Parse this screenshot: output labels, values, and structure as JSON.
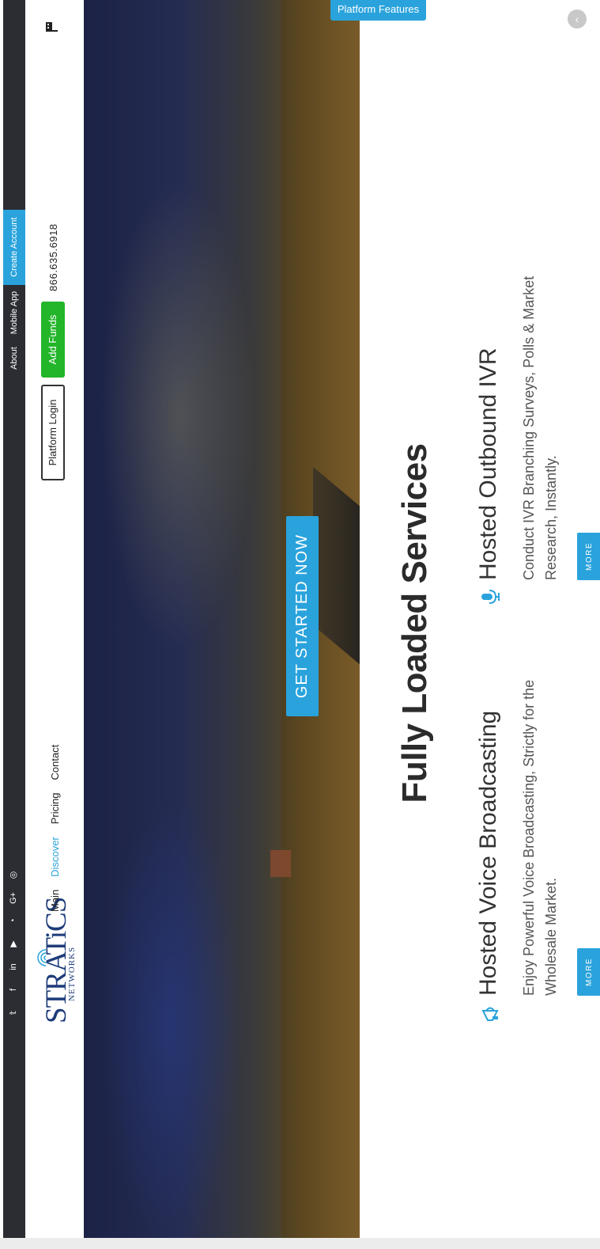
{
  "topbar": {
    "social_icons": [
      "twitter-icon",
      "facebook-icon",
      "linkedin-icon",
      "youtube-icon",
      "rss-icon",
      "google-plus-icon",
      "instagram-icon"
    ],
    "social_glyphs": [
      "𝕥",
      "f",
      "in",
      "▶",
      "◔",
      "G+",
      "◎"
    ],
    "links": {
      "about": "About",
      "mobile_app": "Mobile App",
      "create_account": "Create Account"
    }
  },
  "header": {
    "logo_word": "STRATiCS",
    "logo_sub": "NETWORKS",
    "nav": [
      "Main",
      "Discover",
      "Pricing",
      "Contact"
    ],
    "active_nav": "Discover",
    "platform_login": "Platform Login",
    "add_funds": "Add Funds",
    "phone": "866.635.6918"
  },
  "hero": {
    "cta": "GET STARTED NOW"
  },
  "services": {
    "title": "Fully Loaded Services",
    "items": [
      {
        "icon": "megaphone-icon",
        "title": "Hosted Voice Broadcasting",
        "desc": "Enjoy Powerful Voice Broadcasting, Strictly for the Wholesale Market.",
        "more": "MORE"
      },
      {
        "icon": "microphone-icon",
        "title": "Hosted Outbound IVR",
        "desc": "Conduct IVR Branching Surveys, Polls & Market Research, Instantly.",
        "more": "MORE"
      }
    ]
  },
  "floating": {
    "platform_features": "Platform Features",
    "back_glyph": "‹"
  },
  "colors": {
    "accent": "#2aa3dc",
    "green": "#23b52a",
    "dark": "#2b2d33",
    "logo": "#1e3c7a"
  }
}
